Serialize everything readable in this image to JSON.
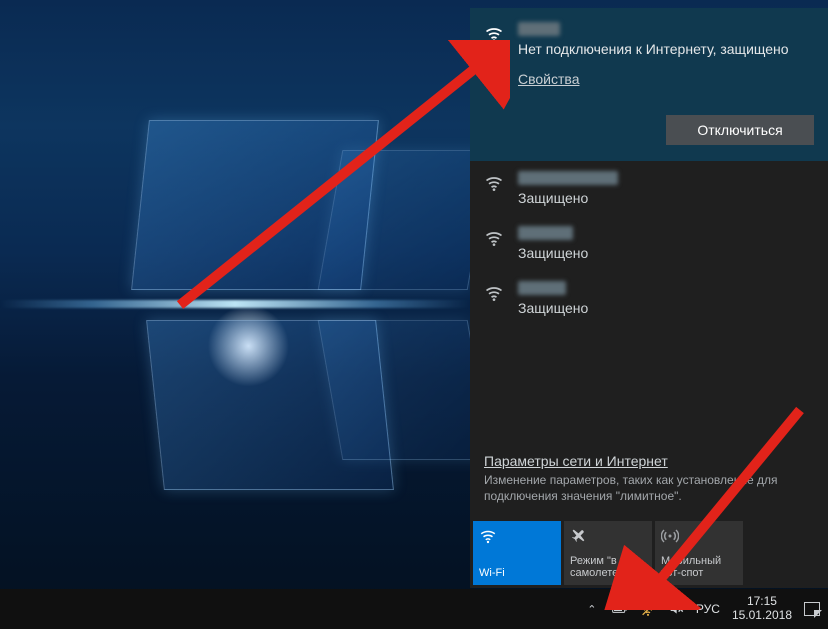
{
  "wallpaper": {
    "name": "Windows 10 default blue light"
  },
  "flyout": {
    "connected": {
      "ssid_hidden": true,
      "status": "Нет подключения к Интернету, защищено",
      "properties_label": "Свойства",
      "disconnect_label": "Отключиться"
    },
    "networks": [
      {
        "ssid_hidden": true,
        "status": "Защищено"
      },
      {
        "ssid_hidden": true,
        "status": "Защищено"
      },
      {
        "ssid_hidden": true,
        "status": "Защищено"
      }
    ],
    "footer": {
      "heading": "Параметры сети и Интернет",
      "sub": "Изменение параметров, таких как установление для подключения значения \"лимитное\"."
    },
    "tiles": {
      "wifi": "Wi-Fi",
      "airplane": "Режим \"в самолете\"",
      "hotspot": "Мобильный хот-спот"
    }
  },
  "taskbar": {
    "lang": "РУС",
    "time": "17:15",
    "date": "15.01.2018"
  },
  "annotations": {
    "arrow1_target": "connected network status line",
    "arrow2_target": "network tray icon in taskbar"
  }
}
